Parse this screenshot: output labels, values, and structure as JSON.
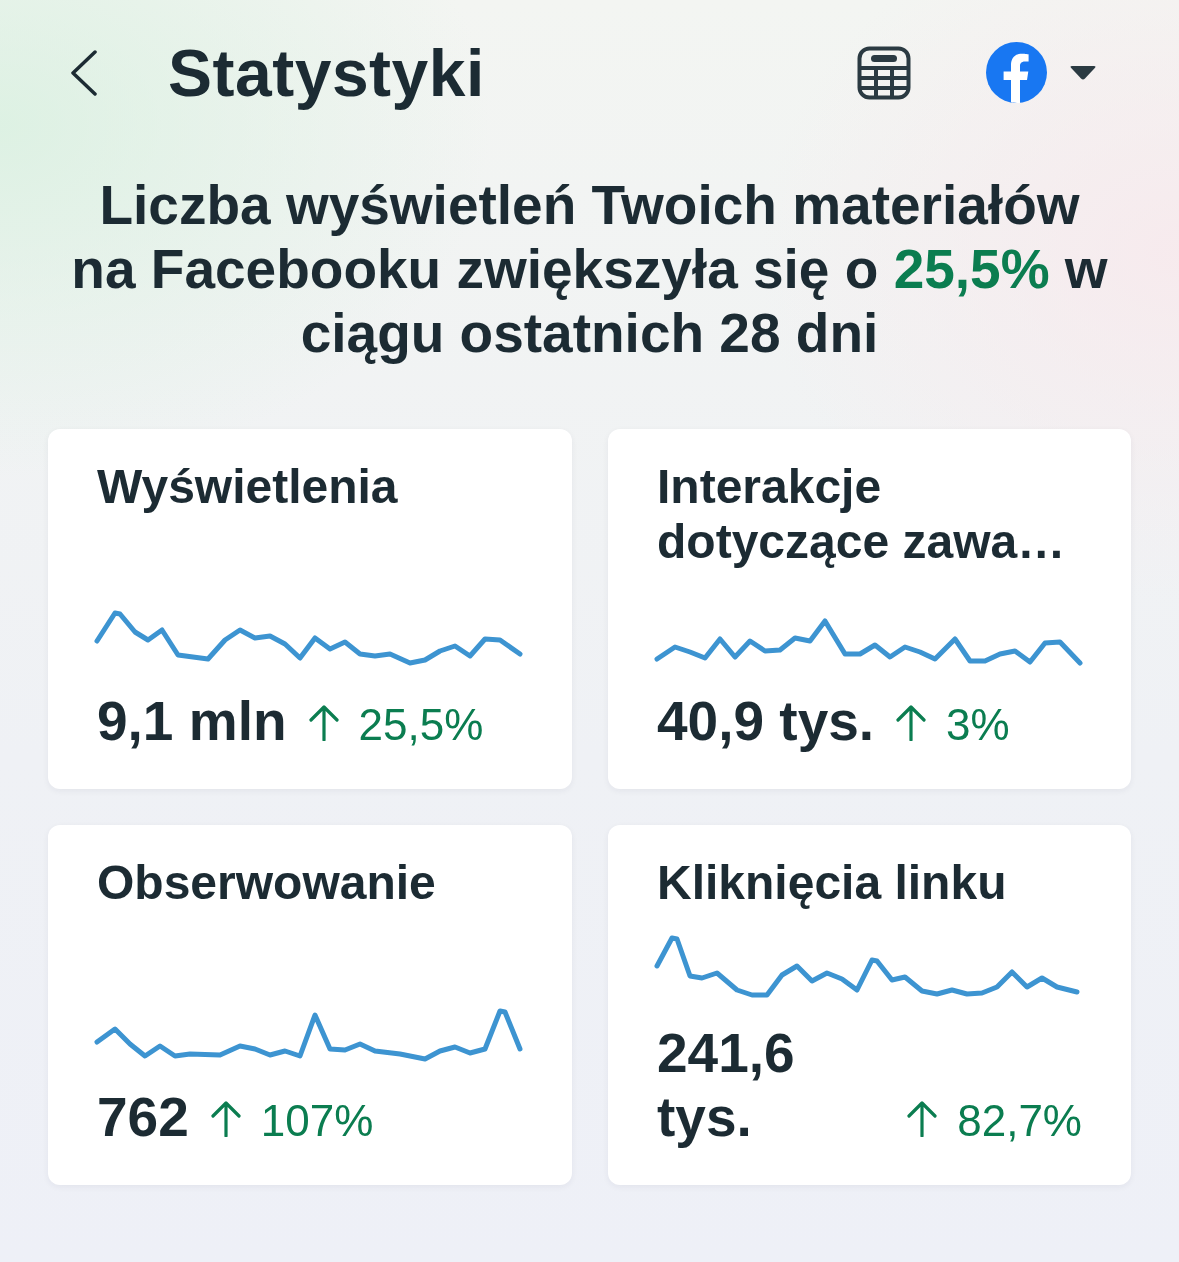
{
  "header": {
    "title": "Statystyki"
  },
  "headline": {
    "text_before": "Liczba wyświetleń Twoich materiałów na Facebooku zwiększyła się o ",
    "highlight": "25,5%",
    "text_after": " w ciągu ostatnich 28 dni"
  },
  "cards": [
    {
      "title": "Wyświetlenia",
      "value": "9,1 mln",
      "change": "25,5%"
    },
    {
      "title": "Interakcje dotyczące zawa…",
      "value": "40,9 tys.",
      "change": "3%"
    },
    {
      "title": "Obserwowanie",
      "value": "762",
      "change": "107%"
    },
    {
      "title": "Kliknięcia linku",
      "value": "241,6 tys.",
      "change": "82,7%"
    }
  ]
}
